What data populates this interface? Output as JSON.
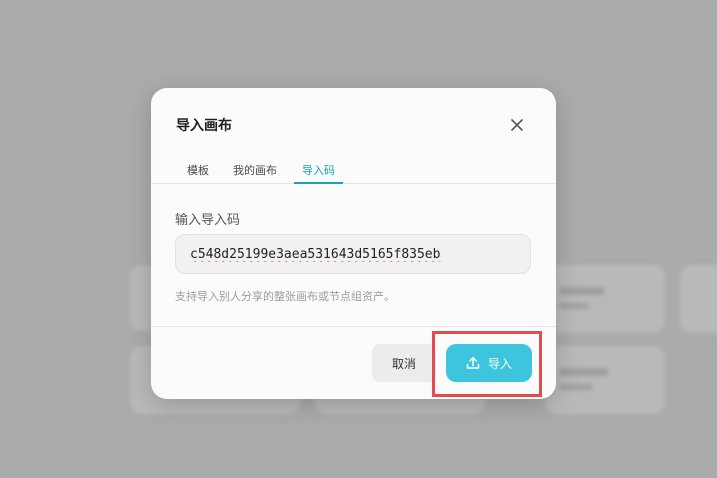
{
  "dialog": {
    "title": "导入画布",
    "close_icon": "close-icon",
    "tabs": [
      {
        "label": "模板",
        "active": false
      },
      {
        "label": "我的画布",
        "active": false
      },
      {
        "label": "导入码",
        "active": true
      }
    ],
    "field_label": "输入导入码",
    "code_value": "c548d25199e3aea531643d5165f835eb",
    "hint": "支持导入别人分享的整张画布或节点组资产。",
    "cancel_label": "取消",
    "import_label": "导入",
    "import_icon": "upload-icon"
  },
  "colors": {
    "accent": "#3cc5dc",
    "tab_active": "#1aa2b5",
    "highlight": "#e24c4c"
  }
}
